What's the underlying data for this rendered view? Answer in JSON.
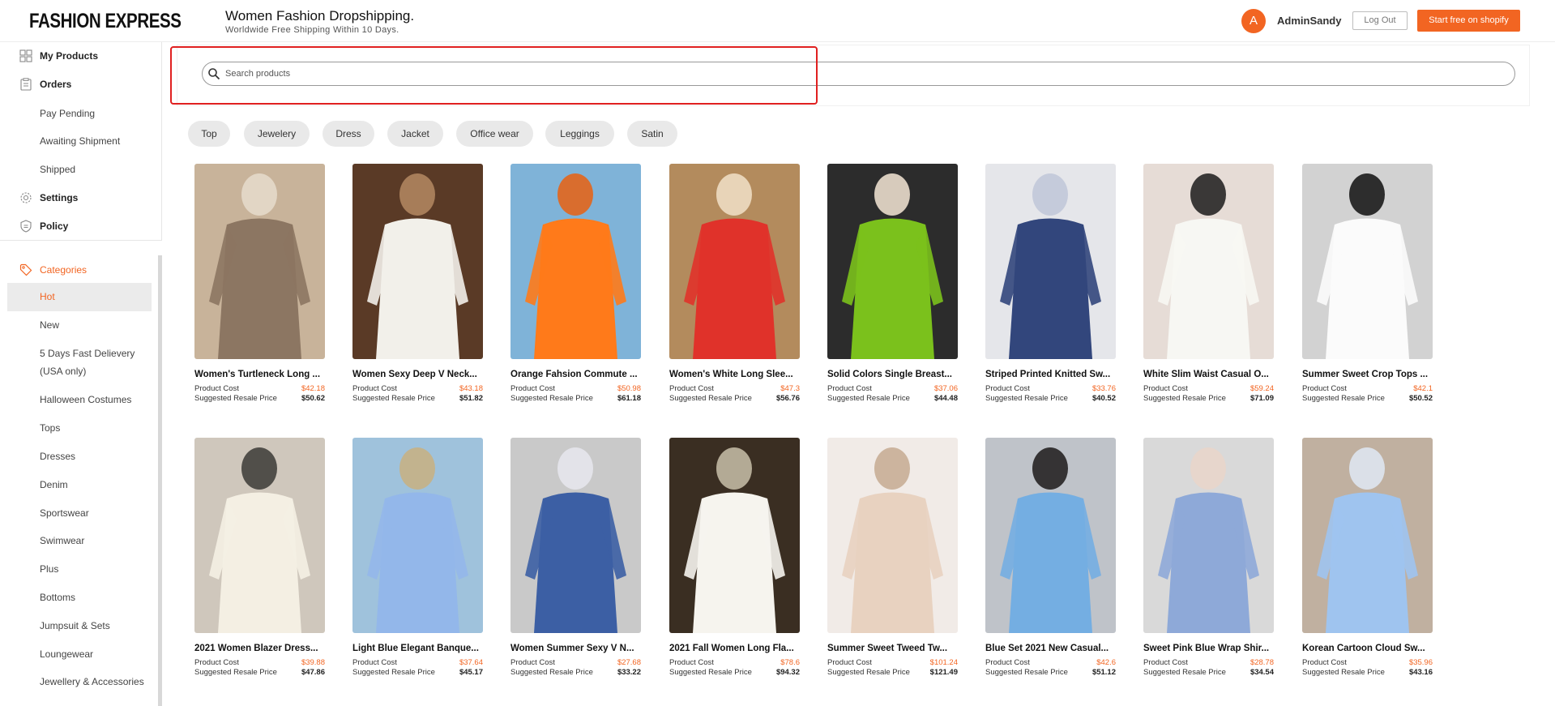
{
  "header": {
    "logo_text": "FASHION EXPRESS",
    "title": "Women Fashion Dropshipping.",
    "subtitle": "Worldwide Free Shipping Within 10 Days.",
    "avatar_letter": "A",
    "username": "AdminSandy",
    "logout_label": "Log Out",
    "shopify_label": "Start free on shopify",
    "accent_color": "#f26522"
  },
  "sidebar": {
    "menu": [
      {
        "label": "My Products",
        "icon": "grid-icon"
      },
      {
        "label": "Orders",
        "icon": "clipboard-icon"
      },
      {
        "label": "Pay Pending"
      },
      {
        "label": "Awaiting Shipment"
      },
      {
        "label": "Shipped"
      },
      {
        "label": "Settings",
        "icon": "gear-icon"
      },
      {
        "label": "Policy",
        "icon": "shield-icon"
      }
    ],
    "categories_title": "Categories",
    "categories": [
      "Hot",
      "New",
      "5 Days Fast Delievery (USA only)",
      "Halloween Costumes",
      "Tops",
      "Dresses",
      "Denim",
      "Sportswear",
      "Swimwear",
      "Plus",
      "Bottoms",
      "Jumpsuit & Sets",
      "Loungewear",
      "Jewellery & Accessories"
    ],
    "active_category": "Hot"
  },
  "search": {
    "placeholder": "Search products",
    "value": ""
  },
  "tags": [
    "Top",
    "Jewelery",
    "Dress",
    "Jacket",
    "Office wear",
    "Leggings",
    "Satin"
  ],
  "labels": {
    "product_cost": "Product Cost",
    "resale_price": "Suggested Resale Price"
  },
  "products": [
    {
      "name": "Women's Turtleneck Long ...",
      "cost": "$42.18",
      "resale": "$50.62"
    },
    {
      "name": "Women Sexy Deep V Neck...",
      "cost": "$43.18",
      "resale": "$51.82"
    },
    {
      "name": "Orange Fahsion Commute ...",
      "cost": "$50.98",
      "resale": "$61.18"
    },
    {
      "name": "Women's White Long Slee...",
      "cost": "$47.3",
      "resale": "$56.76"
    },
    {
      "name": "Solid Colors Single Breast...",
      "cost": "$37.06",
      "resale": "$44.48"
    },
    {
      "name": "Striped Printed Knitted Sw...",
      "cost": "$33.76",
      "resale": "$40.52"
    },
    {
      "name": "White Slim Waist Casual O...",
      "cost": "$59.24",
      "resale": "$71.09"
    },
    {
      "name": "Summer Sweet Crop Tops ...",
      "cost": "$42.1",
      "resale": "$50.52"
    },
    {
      "name": "2021 Women Blazer Dress...",
      "cost": "$39.88",
      "resale": "$47.86"
    },
    {
      "name": "Light Blue Elegant Banque...",
      "cost": "$37.64",
      "resale": "$45.17"
    },
    {
      "name": "Women Summer Sexy V N...",
      "cost": "$27.68",
      "resale": "$33.22"
    },
    {
      "name": "2021 Fall Women Long Fla...",
      "cost": "$78.6",
      "resale": "$94.32"
    },
    {
      "name": "Summer Sweet Tweed Tw...",
      "cost": "$101.24",
      "resale": "$121.49"
    },
    {
      "name": "Blue Set 2021 New Casual...",
      "cost": "$42.6",
      "resale": "$51.12"
    },
    {
      "name": "Sweet Pink Blue Wrap Shir...",
      "cost": "$28.78",
      "resale": "$34.54"
    },
    {
      "name": "Korean Cartoon Cloud Sw...",
      "cost": "$35.96",
      "resale": "$43.16"
    }
  ]
}
